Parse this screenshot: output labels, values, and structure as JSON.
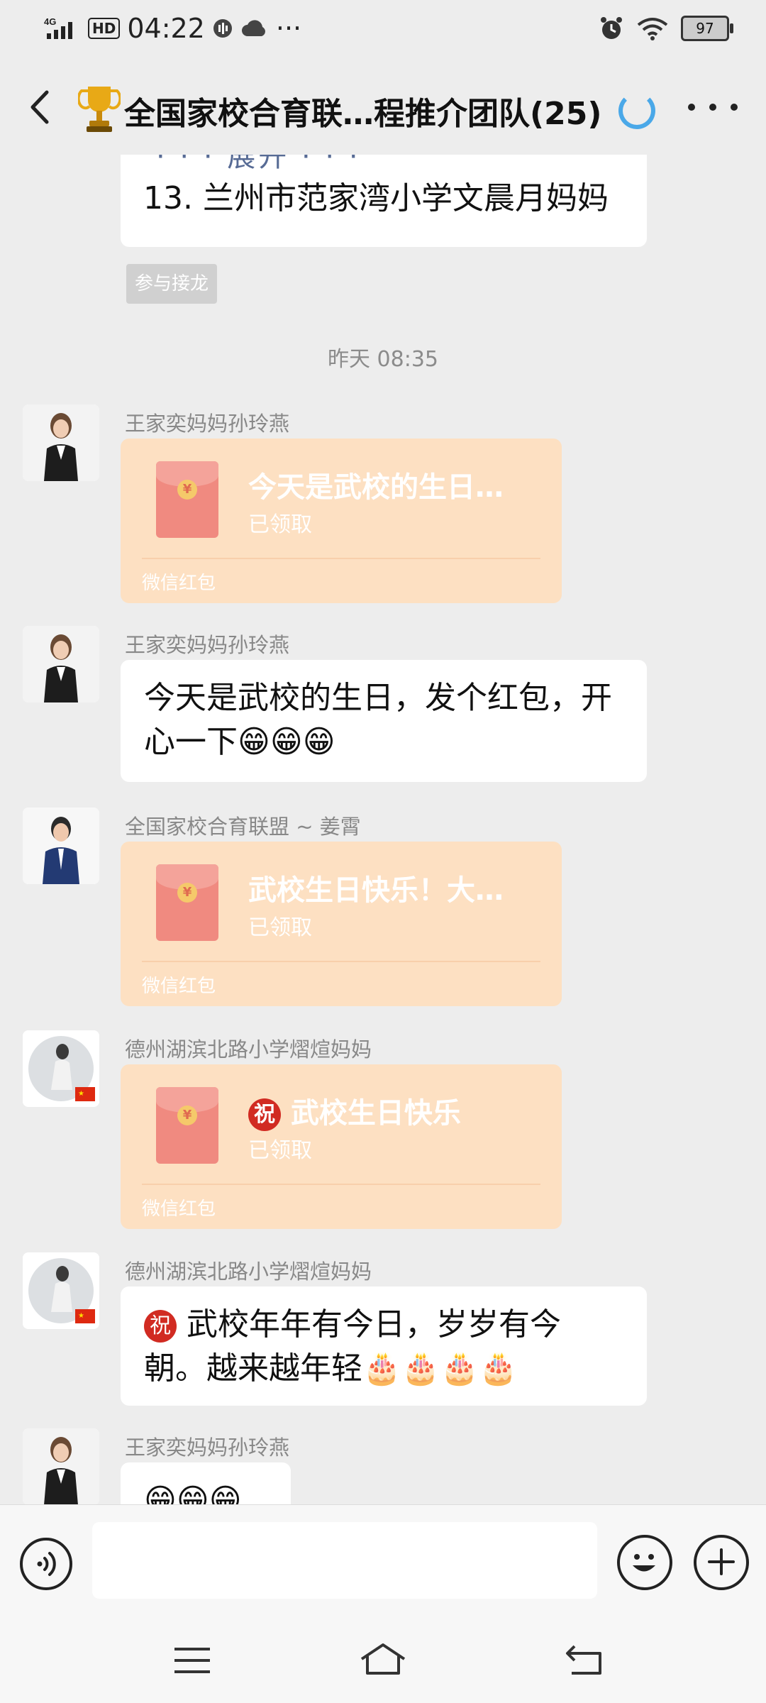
{
  "status_bar": {
    "network": "4G",
    "hd": "HD",
    "time": "04:22",
    "more": "···",
    "battery": "97"
  },
  "header": {
    "title": "全国家校合育联…程推介团队(25)"
  },
  "messages": {
    "top_expand": "· · · 展开 · · ·",
    "top_text": "13. 兰州市范家湾小学文晨月妈妈",
    "join_button": "参与接龙",
    "timestamp": "昨天 08:35",
    "m1_sender": "王家奕妈妈孙玲燕",
    "m1_title": "今天是武校的生日…",
    "m1_status": "已领取",
    "m1_footer": "微信红包",
    "m2_sender": "王家奕妈妈孙玲燕",
    "m2_line1": "今天是武校的生日，发个红包，开",
    "m2_line2": "心一下😁😁😁",
    "m3_sender": "全国家校合育联盟 ~ 姜霄",
    "m3_title": "武校生日快乐！大…",
    "m3_status": "已领取",
    "m3_footer": "微信红包",
    "m4_sender": "德州湖滨北路小学熠煊妈妈",
    "m4_badge": "祝",
    "m4_title": "武校生日快乐",
    "m4_status": "已领取",
    "m4_footer": "微信红包",
    "m5_sender": "德州湖滨北路小学熠煊妈妈",
    "m5_badge": "祝",
    "m5_line1": "武校年年有今日，岁岁有今",
    "m5_line2": "朝。越来越年轻🎂🎂🎂🎂",
    "m6_sender": "王家奕妈妈孙玲燕",
    "m6_text": "😁😁😁"
  },
  "icons": {
    "back": "back-arrow-icon",
    "trophy": "trophy-icon",
    "loading": "loading-spinner-icon",
    "more": "more-dots-icon",
    "voice": "voice-icon",
    "emoji": "emoji-icon",
    "plus": "plus-icon",
    "menu": "menu-icon",
    "home": "home-icon",
    "back_nav": "back-nav-icon"
  },
  "colors": {
    "accent_blue": "#4aa8e8",
    "red_packet": "#fde0c2",
    "envelope": "#f08a80"
  }
}
